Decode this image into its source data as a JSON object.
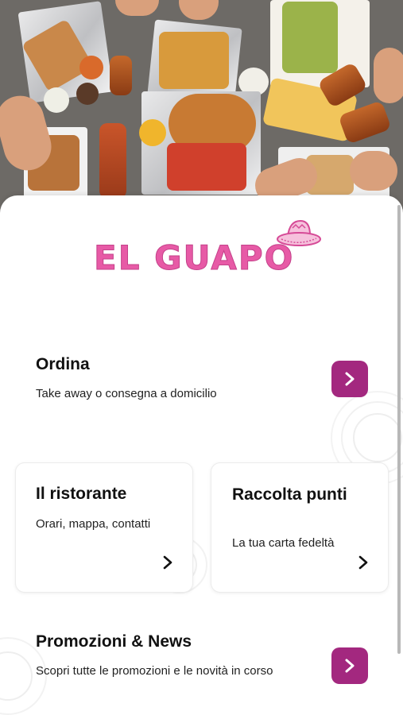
{
  "brand": {
    "logo_text": "EL GUAPO",
    "color": "#e75aa6"
  },
  "accent_color": "#a3287f",
  "order": {
    "title": "Ordina",
    "subtitle": "Take away o consegna a domicilio",
    "icon": "chevron-right-icon"
  },
  "restaurant": {
    "title": "Il ristorante",
    "subtitle": "Orari, mappa, contatti",
    "icon": "chevron-right-icon"
  },
  "loyalty": {
    "title": "Raccolta punti",
    "subtitle": "La tua carta fedeltà",
    "icon": "chevron-right-icon"
  },
  "promo": {
    "title": "Promozioni & News",
    "subtitle": "Scopri tutte le promozioni e le novità in corso",
    "icon": "chevron-right-icon"
  }
}
